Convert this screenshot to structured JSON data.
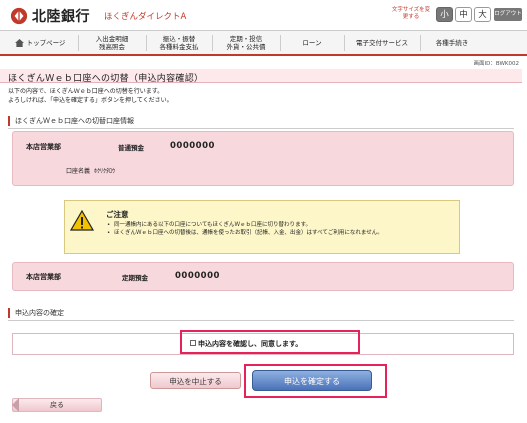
{
  "header": {
    "bank_name": "北陸銀行",
    "service_name": "ほくぎんダイレクトA",
    "font_size_label": "文字サイズを変更する",
    "font_sizes": [
      "小",
      "中",
      "大"
    ],
    "logout_label": "ログアウト"
  },
  "nav": {
    "items": [
      {
        "label": "トップページ"
      },
      {
        "label": "入出金明細\n残高照会"
      },
      {
        "label": "振込・振替\n各種料金支払"
      },
      {
        "label": "定期・投信\n外貨・公共債"
      },
      {
        "label": "ローン"
      },
      {
        "label": "電子交付サービス"
      },
      {
        "label": "各種手続き"
      }
    ]
  },
  "screen_id": "画面ID：BWK002",
  "page": {
    "title": "ほくぎんＷｅｂ口座への切替（申込内容確認）",
    "description_line1": "以下の内容で、ほくぎんＷｅｂ口座への切替を行います。",
    "description_line2": "よろしければ、「申込を確定する」ボタンを押してください。"
  },
  "account_section": {
    "heading": "ほくぎんＷｅｂ口座への切替口座情報",
    "branch": "本店営業部",
    "account_type": "普通預金",
    "account_number": "0000000",
    "holder_label": "口座名義",
    "holder_name": "ﾎｸﾘｸﾀﾛｳ"
  },
  "caution": {
    "title": "ご注意",
    "items": [
      "同一通帳内にある以下の口座についてもほくぎんＷｅｂ口座に切り替わります。",
      "ほくぎんＷｅｂ口座への切替後は、通帳を使ったお取引（記帳、入金、出金）はすべてご利用になれません。"
    ]
  },
  "related_account": {
    "branch": "本店営業部",
    "account_type": "定期預金",
    "account_number": "0000000"
  },
  "confirm_section": {
    "heading": "申込内容の確定",
    "checkbox_label": "申込内容を確認し、同意します。"
  },
  "buttons": {
    "cancel": "申込を中止する",
    "confirm": "申込を確定する",
    "back": "戻る"
  },
  "colors": {
    "brand_red": "#c0392b",
    "pink_panel": "#f7d8dd",
    "highlight": "#e5225a",
    "confirm_blue": "#4a72b8",
    "caution_yellow": "#fdf6c8"
  }
}
